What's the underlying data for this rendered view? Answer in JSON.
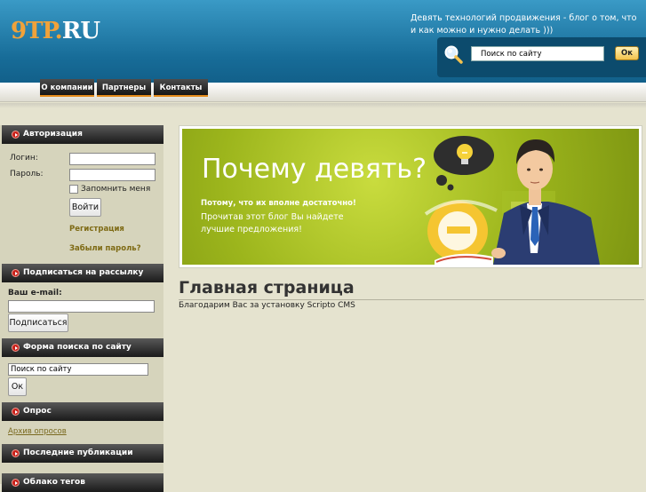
{
  "header": {
    "logo_part1": "9TP.",
    "logo_part2": "RU",
    "tagline": "Девять технологий продвижения - блог о том, что и как можно и нужно делать )))",
    "search": {
      "placeholder": "Поиск по сайту",
      "value": "Поиск по сайту",
      "button": "Ок"
    }
  },
  "nav": [
    "О компании",
    "Партнеры",
    "Контакты"
  ],
  "sidebar": {
    "auth": {
      "title": "Авторизация",
      "login_label": "Логин:",
      "password_label": "Пароль:",
      "remember_label": "Запомнить меня",
      "login_button": "Войти",
      "register_link": "Регистрация",
      "forgot_link": "Забыли пароль?"
    },
    "subscribe": {
      "title": "Подписаться на рассылку",
      "email_label": "Ваш e-mail:",
      "button": "Подписаться"
    },
    "search": {
      "title": "Форма поиска по сайту",
      "value": "Поиск по сайту",
      "button": "Ок"
    },
    "poll": {
      "title": "Опрос",
      "archive_link": "Архив опросов"
    },
    "latest": {
      "title": "Последние публикации"
    },
    "tags": {
      "title": "Облако тегов"
    }
  },
  "banner": {
    "title": "Почему девять?",
    "subtitle": "Потому, что их вполне достаточно!",
    "text": "Прочитав этот блог Вы найдете лучшие предложения!"
  },
  "main": {
    "title": "Главная страница",
    "text": "Благодарим Вас за установку Scripto CMS"
  },
  "colors": {
    "header_blue": "#1f78a6",
    "accent_orange": "#f0a23a",
    "sidebar_bg": "#d6d4bc",
    "page_bg": "#e5e3cf",
    "banner_green": "#a5bd22"
  }
}
